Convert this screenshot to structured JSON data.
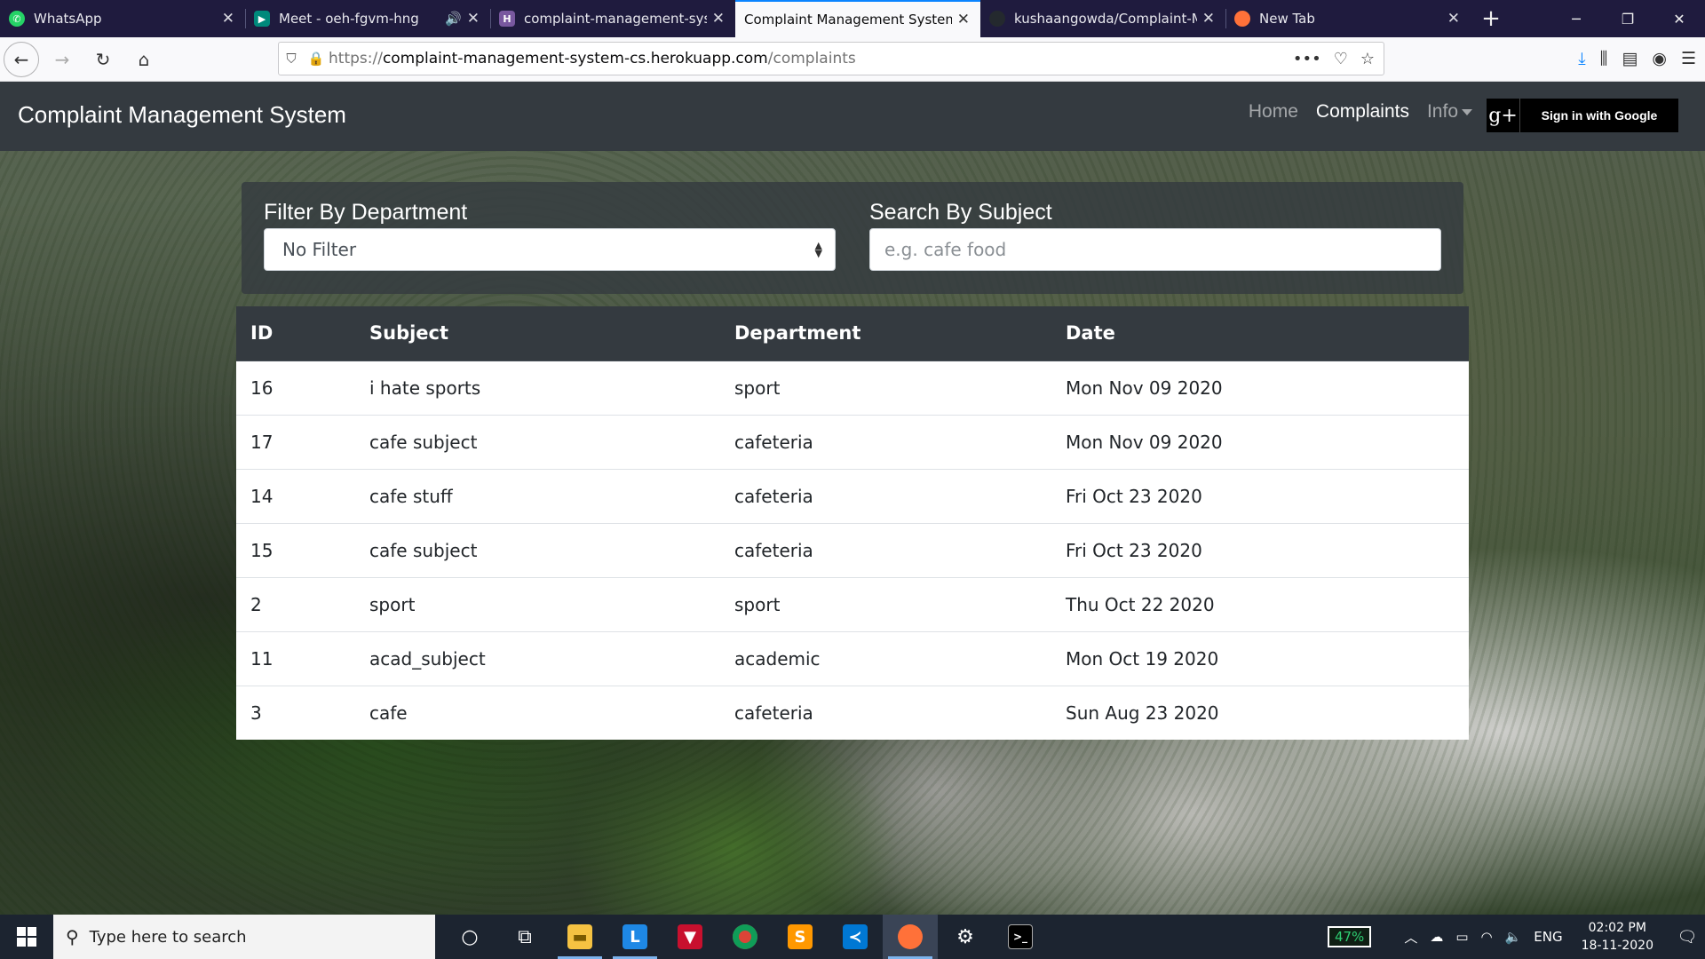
{
  "browser": {
    "tabs": [
      {
        "title": "WhatsApp",
        "icon": "whatsapp-icon",
        "color": "#25d366",
        "active": false
      },
      {
        "title": "Meet - oeh-fgvm-hng",
        "icon": "meet-icon",
        "color": "#00897b",
        "active": false
      },
      {
        "title": "complaint-management-system",
        "icon": "heroku-icon",
        "color": "#79589f",
        "active": false
      },
      {
        "title": "Complaint Management System",
        "icon": "",
        "color": "",
        "active": true
      },
      {
        "title": "kushaangowda/Complaint-Ma",
        "icon": "github-icon",
        "color": "#24292e",
        "active": false
      },
      {
        "title": "New Tab",
        "icon": "firefox-icon",
        "color": "#ff7139",
        "active": false
      }
    ],
    "url_prefix": "https://",
    "url_domain": "complaint-management-system-cs.herokuapp.com",
    "url_path": "/complaints"
  },
  "app": {
    "brand": "Complaint Management System",
    "nav": {
      "home": "Home",
      "complaints": "Complaints",
      "info": "Info"
    },
    "signin_label": "Sign in with Google",
    "google_icon_text": "g+"
  },
  "filters": {
    "department_label": "Filter By Department",
    "department_value": "No Filter",
    "subject_label": "Search By Subject",
    "subject_placeholder": "e.g. cafe food"
  },
  "table": {
    "headers": [
      "ID",
      "Subject",
      "Department",
      "Date"
    ],
    "rows": [
      [
        "16",
        "i hate sports",
        "sport",
        "Mon Nov 09 2020"
      ],
      [
        "17",
        "cafe subject",
        "cafeteria",
        "Mon Nov 09 2020"
      ],
      [
        "14",
        "cafe stuff",
        "cafeteria",
        "Fri Oct 23 2020"
      ],
      [
        "15",
        "cafe subject",
        "cafeteria",
        "Fri Oct 23 2020"
      ],
      [
        "2",
        "sport",
        "sport",
        "Thu Oct 22 2020"
      ],
      [
        "11",
        "acad_subject",
        "academic",
        "Mon Oct 19 2020"
      ],
      [
        "3",
        "cafe",
        "cafeteria",
        "Sun Aug 23 2020"
      ]
    ]
  },
  "taskbar": {
    "search_placeholder": "Type here to search",
    "battery": "47%",
    "language": "ENG",
    "time": "02:02 PM",
    "date": "18-11-2020"
  }
}
